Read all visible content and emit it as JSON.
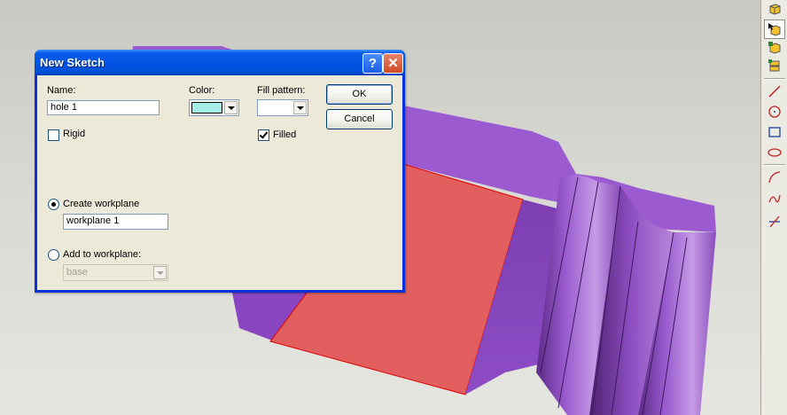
{
  "dialog": {
    "title": "New Sketch",
    "help_glyph": "?",
    "close_glyph": "✕",
    "name_label": "Name:",
    "name_value": "hole 1",
    "color_label": "Color:",
    "color_value": "#a6ece6",
    "fill_label": "Fill pattern:",
    "rigid_label": "Rigid",
    "rigid_checked": false,
    "filled_label": "Filled",
    "filled_checked": true,
    "ok_label": "OK",
    "cancel_label": "Cancel",
    "create_workplane_label": "Create workplane",
    "create_workplane_selected": true,
    "workplane_value": "workplane 1",
    "add_to_workplane_label": "Add to workplane:",
    "add_to_workplane_value": "base"
  },
  "toolbar": {
    "icons": [
      "box-create-icon",
      "box-select-icon",
      "box-add-icon",
      "box-stack-icon",
      "line-icon",
      "circle-icon",
      "rectangle-icon",
      "ellipse-icon",
      "arc-icon",
      "spline-icon",
      "trim-icon"
    ]
  },
  "colors": {
    "model_face": "#9b5cc8",
    "model_side": "#7a38b0",
    "selected_face": "#e06060",
    "dialog_bg": "#ece9d8",
    "title_blue": "#0054e3"
  }
}
